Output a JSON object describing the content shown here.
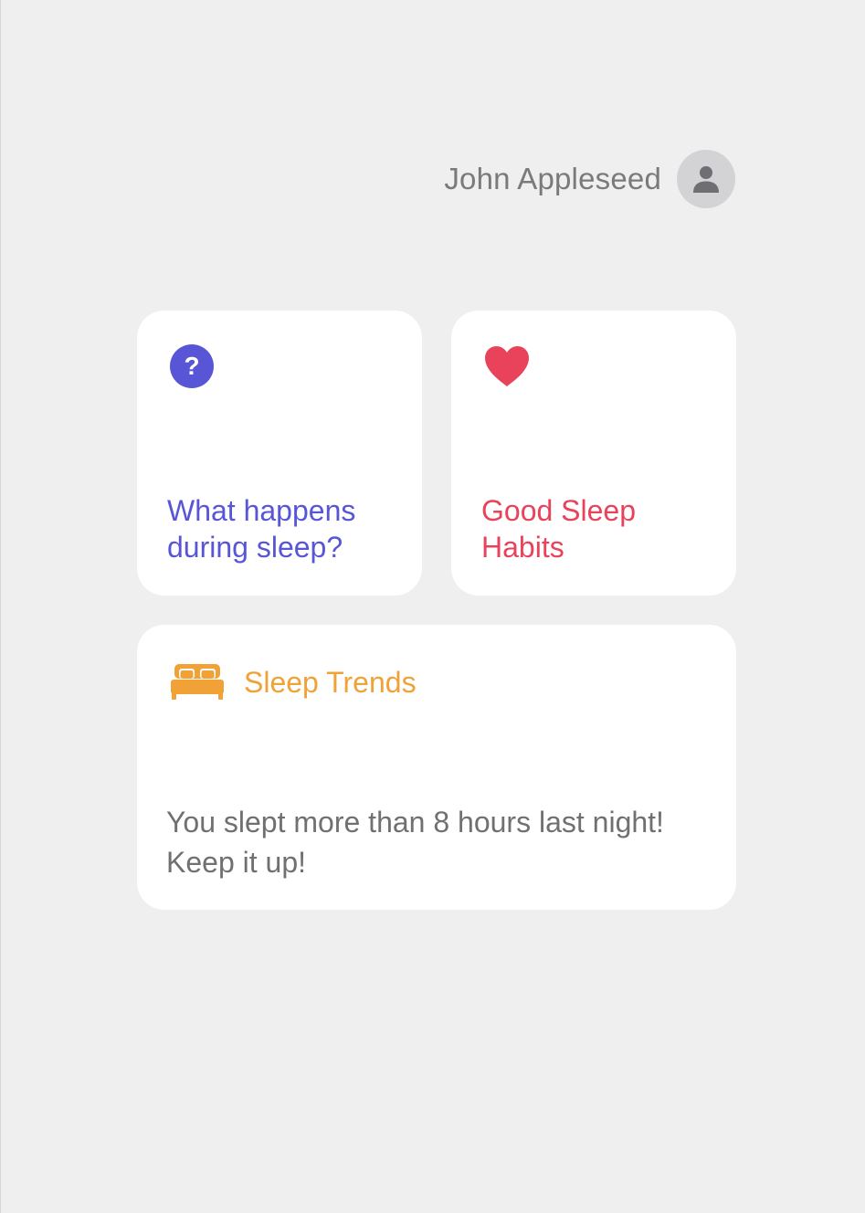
{
  "profile": {
    "name": "John Appleseed",
    "avatar_icon": "person-icon"
  },
  "cards": {
    "sleep_info": {
      "title": "What happens during sleep?",
      "icon": "question-mark-circle-icon",
      "color": "#5856d6"
    },
    "habits": {
      "title": "Good Sleep Habits",
      "icon": "heart-icon",
      "color": "#e8435a"
    },
    "trends": {
      "title": "Sleep Trends",
      "icon": "bed-icon",
      "color": "#f0a236",
      "message": "You slept more than 8 hours last night! Keep it up!"
    }
  },
  "colors": {
    "background": "#efefef",
    "card": "#ffffff",
    "secondary_text": "#707070"
  }
}
